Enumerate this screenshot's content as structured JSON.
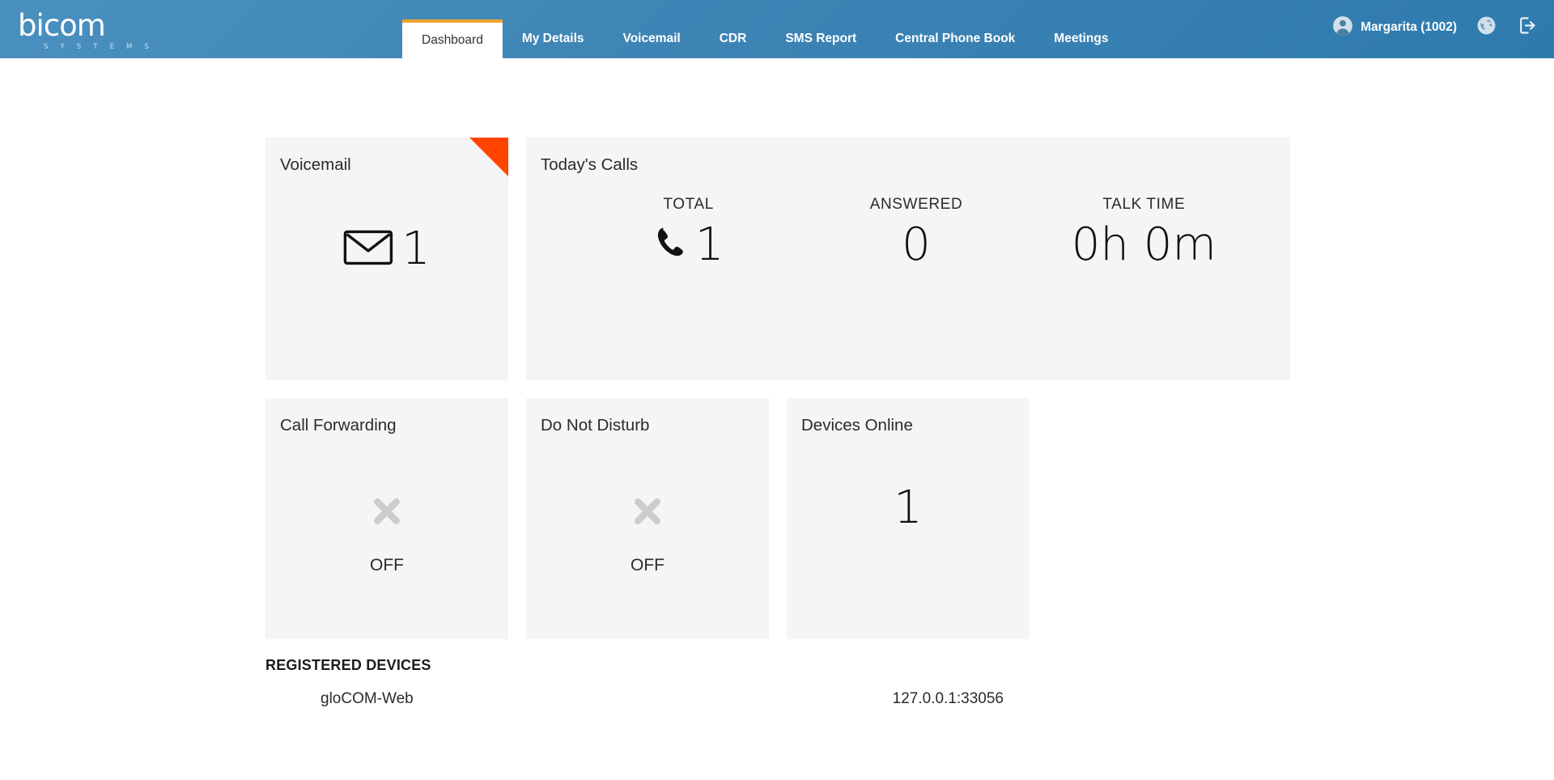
{
  "brand": {
    "logo_text": "bicom",
    "logo_sub": "S Y S T E M S"
  },
  "nav": {
    "tabs": [
      {
        "label": "Dashboard",
        "active": true
      },
      {
        "label": "My Details",
        "active": false
      },
      {
        "label": "Voicemail",
        "active": false
      },
      {
        "label": "CDR",
        "active": false
      },
      {
        "label": "SMS Report",
        "active": false
      },
      {
        "label": "Central Phone Book",
        "active": false
      },
      {
        "label": "Meetings",
        "active": false
      }
    ]
  },
  "header_right": {
    "user_name": "Margarita (1002)",
    "avatar_icon": "user-avatar-icon",
    "language_icon": "globe-icon",
    "logout_icon": "logout-icon"
  },
  "cards": {
    "voicemail": {
      "title": "Voicemail",
      "count": "1",
      "icon": "envelope-icon",
      "ribbon_color": "#FF4500"
    },
    "todays_calls": {
      "title": "Today's Calls",
      "stats": [
        {
          "label": "TOTAL",
          "value": "1",
          "icon": "phone-icon"
        },
        {
          "label": "ANSWERED",
          "value": "0",
          "icon": ""
        },
        {
          "label": "TALK TIME",
          "value": "0h 0m",
          "icon": ""
        }
      ]
    },
    "call_forwarding": {
      "title": "Call Forwarding",
      "state": "OFF",
      "icon": "cross-icon"
    },
    "do_not_disturb": {
      "title": "Do Not Disturb",
      "state": "OFF",
      "icon": "cross-icon"
    },
    "devices_online": {
      "title": "Devices Online",
      "count": "1"
    }
  },
  "registered_devices": {
    "title": "REGISTERED DEVICES",
    "rows": [
      {
        "device": "gloCOM-Web",
        "address": "127.0.0.1:33056"
      }
    ]
  },
  "colors": {
    "header_blue": "#3F85B6",
    "accent_orange": "#F0A22E",
    "ribbon_orange": "#FF4500",
    "card_bg": "#F5F5F5"
  }
}
